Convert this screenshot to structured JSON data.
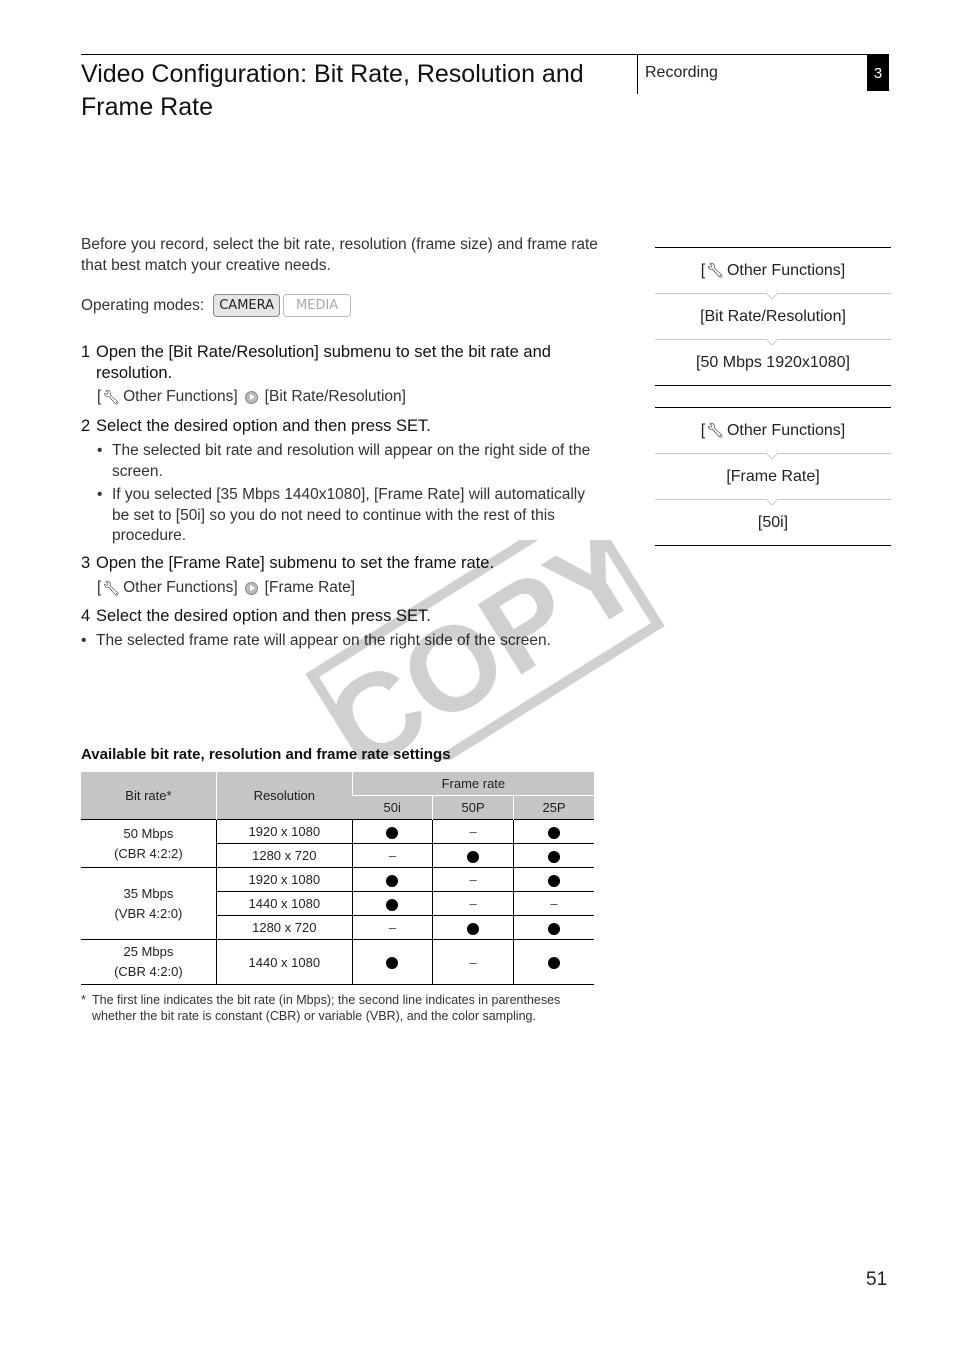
{
  "header": {
    "title": "Video Configuration: Bit Rate, Resolution and Frame Rate",
    "section": "Recording",
    "chapter": "3"
  },
  "intro": "Before you record, select the bit rate, resolution (frame size) and frame rate that best match your creative needs.",
  "operating_modes": {
    "label": "Operating modes:",
    "modes": [
      {
        "label": "CAMERA",
        "active": true
      },
      {
        "label": "MEDIA",
        "active": false
      }
    ]
  },
  "steps": [
    {
      "num": "1",
      "text": "Open the [Bit Rate/Resolution] submenu to set the bit rate and resolution.",
      "path": {
        "from": "Other Functions]",
        "to": "[Bit Rate/Resolution]"
      }
    },
    {
      "num": "2",
      "text": "Select the desired option and then press SET.",
      "bullets": [
        "The selected bit rate and resolution will appear on the right side of the screen.",
        "If you selected [35 Mbps 1440x1080], [Frame Rate] will automatically be set to [50i] so you do not need to continue with the rest of this procedure."
      ]
    },
    {
      "num": "3",
      "text": "Open the [Frame Rate] submenu to set the frame rate.",
      "path": {
        "from": "Other Functions]",
        "to": "[Frame Rate]"
      }
    },
    {
      "num": "4",
      "text": "Select the desired option and then press SET.",
      "bullets": [
        "The selected frame rate will appear on the right side of the screen."
      ]
    }
  ],
  "bracket_open": "[",
  "bullet_char": "•",
  "wrench_icon": "wrench-icon",
  "menus": [
    {
      "items": [
        "Other Functions]",
        "[Bit Rate/Resolution]",
        "[50 Mbps 1920x1080]"
      ]
    },
    {
      "items": [
        "Other Functions]",
        "[Frame Rate]",
        "[50i]"
      ]
    }
  ],
  "watermark": "COPY",
  "table": {
    "title": "Available bit rate, resolution and frame rate settings",
    "headers": {
      "bit_rate": "Bit rate*",
      "resolution": "Resolution",
      "frame_rate": "Frame rate",
      "rates": [
        "50i",
        "50P",
        "25P"
      ]
    },
    "groups": [
      {
        "bit_rate": "50 Mbps",
        "mode": "(CBR 4:2:2)",
        "rows": [
          {
            "resolution": "1920 x 1080",
            "values": [
              true,
              false,
              true
            ]
          },
          {
            "resolution": "1280 x 720",
            "values": [
              false,
              true,
              true
            ]
          }
        ]
      },
      {
        "bit_rate": "35 Mbps",
        "mode": "(VBR 4:2:0)",
        "rows": [
          {
            "resolution": "1920 x 1080",
            "values": [
              true,
              false,
              true
            ]
          },
          {
            "resolution": "1440 x 1080",
            "values": [
              true,
              false,
              false
            ]
          },
          {
            "resolution": "1280 x 720",
            "values": [
              false,
              true,
              true
            ]
          }
        ]
      },
      {
        "bit_rate": "25 Mbps",
        "mode": "(CBR 4:2:0)",
        "rows": [
          {
            "resolution": "1440 x 1080",
            "values": [
              true,
              false,
              true
            ]
          }
        ]
      }
    ],
    "unavailable_mark": "–",
    "footnote": {
      "star": "*",
      "line1": "The first line indicates the bit rate (in Mbps); the second line indicates in parentheses",
      "line2": "whether the bit rate is constant (CBR) or variable (VBR), and the color sampling."
    }
  },
  "page_number": "51"
}
